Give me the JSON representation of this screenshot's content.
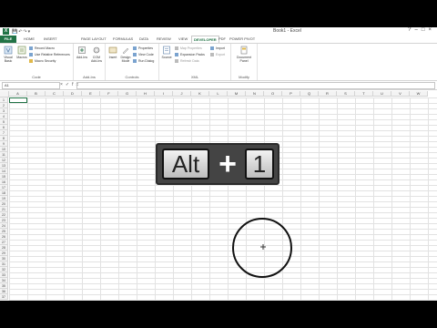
{
  "window": {
    "app_icon": "X",
    "doc_title": "Book1 - Excel",
    "controls": [
      "?",
      "–",
      "□",
      "×"
    ]
  },
  "ribbon_tabs": [
    "FILE",
    "HOME",
    "INSERT",
    "PAGE LAYOUT",
    "FORMULAS",
    "DATA",
    "REVIEW",
    "VIEW",
    "DEVELOPER",
    "PDF",
    "POWER PIVOT"
  ],
  "active_tab": "DEVELOPER",
  "ribbon": {
    "code": {
      "label": "Code",
      "visual_basic": "Visual Basic",
      "macros": "Macros",
      "record_macro": "Record Macro",
      "use_relative": "Use Relative References",
      "macro_security": "Macro Security"
    },
    "addins": {
      "label": "Add-Ins",
      "add_ins": "Add-Ins",
      "com_add_ins": "COM Add-Ins"
    },
    "controls": {
      "label": "Controls",
      "insert": "Insert",
      "design_mode": "Design Mode",
      "properties": "Properties",
      "view_code": "View Code",
      "run_dialog": "Run Dialog"
    },
    "xml": {
      "label": "XML",
      "source": "Source",
      "map_properties": "Map Properties",
      "expansion_packs": "Expansion Packs",
      "refresh_data": "Refresh Data",
      "import": "Import",
      "export": "Export"
    },
    "modify": {
      "label": "Modify",
      "document_panel": "Document Panel"
    }
  },
  "formula_bar": {
    "name_box": "A1",
    "fx": "fx",
    "value": ""
  },
  "columns": [
    "A",
    "B",
    "C",
    "D",
    "E",
    "F",
    "G",
    "H",
    "I",
    "J",
    "K",
    "L",
    "M",
    "N",
    "O",
    "P",
    "Q",
    "R",
    "S",
    "T",
    "U",
    "V",
    "W"
  ],
  "rows": [
    "1",
    "2",
    "3",
    "4",
    "5",
    "6",
    "7",
    "8",
    "9",
    "10",
    "11",
    "12",
    "13",
    "14",
    "15",
    "16",
    "17",
    "18",
    "19",
    "20",
    "21",
    "22",
    "23",
    "24",
    "25",
    "26",
    "27",
    "28",
    "29",
    "30",
    "31",
    "32",
    "33",
    "34",
    "35",
    "36",
    "37"
  ],
  "shortcut": {
    "key1": "Alt",
    "plus": "+",
    "key2": "1"
  },
  "colors": {
    "excel_green": "#217346",
    "overlay_bg": "#444444"
  }
}
